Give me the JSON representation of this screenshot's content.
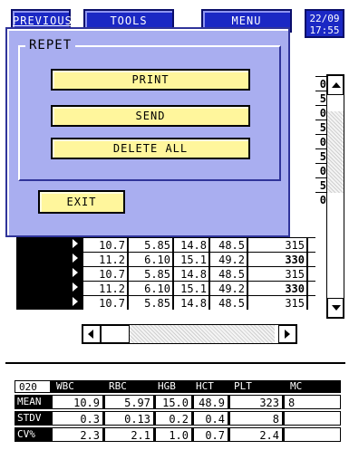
{
  "topbar": {
    "previous_label": "PREVIOUS",
    "tools_label": "TOOLS",
    "menu_label": "MENU",
    "date": "22/09",
    "time": "17:55"
  },
  "dialog": {
    "group_title": "REPET",
    "print_label": "PRINT",
    "send_label": "SEND",
    "delete_all_label": "DELETE ALL",
    "exit_label": "EXIT"
  },
  "table": {
    "strip_values": [
      "0",
      "5",
      "0",
      "5",
      "0",
      "5",
      "0",
      "5",
      "0"
    ],
    "rows": [
      {
        "wbc": "10.7",
        "rbc": "5.85",
        "hgb": "14.8",
        "hct": "48.5",
        "plt": "315",
        "plt_bold": false
      },
      {
        "wbc": "11.2",
        "rbc": "6.10",
        "hgb": "15.1",
        "hct": "49.2",
        "plt": "330",
        "plt_bold": true
      },
      {
        "wbc": "10.7",
        "rbc": "5.85",
        "hgb": "14.8",
        "hct": "48.5",
        "plt": "315",
        "plt_bold": false
      },
      {
        "wbc": "11.2",
        "rbc": "6.10",
        "hgb": "15.1",
        "hct": "49.2",
        "plt": "330",
        "plt_bold": true
      },
      {
        "wbc": "10.7",
        "rbc": "5.85",
        "hgb": "14.8",
        "hct": "48.5",
        "plt": "315",
        "plt_bold": false
      }
    ]
  },
  "stats": {
    "count": "020",
    "headers": [
      "WBC",
      "RBC",
      "HGB",
      "HCT",
      "PLT",
      "MC"
    ],
    "rows": [
      {
        "label": "MEAN",
        "values": [
          "10.9",
          "5.97",
          "15.0",
          "48.9",
          "323",
          "8"
        ]
      },
      {
        "label": "STDV",
        "values": [
          "0.3",
          "0.13",
          "0.2",
          "0.4",
          "8",
          ""
        ]
      },
      {
        "label": "CV%",
        "values": [
          "2.3",
          "2.1",
          "1.0",
          "0.7",
          "2.4",
          ""
        ]
      }
    ]
  },
  "colors": {
    "button_blue": "#1b28c4",
    "dialog_bg": "#a9aef0",
    "dialog_button": "#fff69c"
  }
}
